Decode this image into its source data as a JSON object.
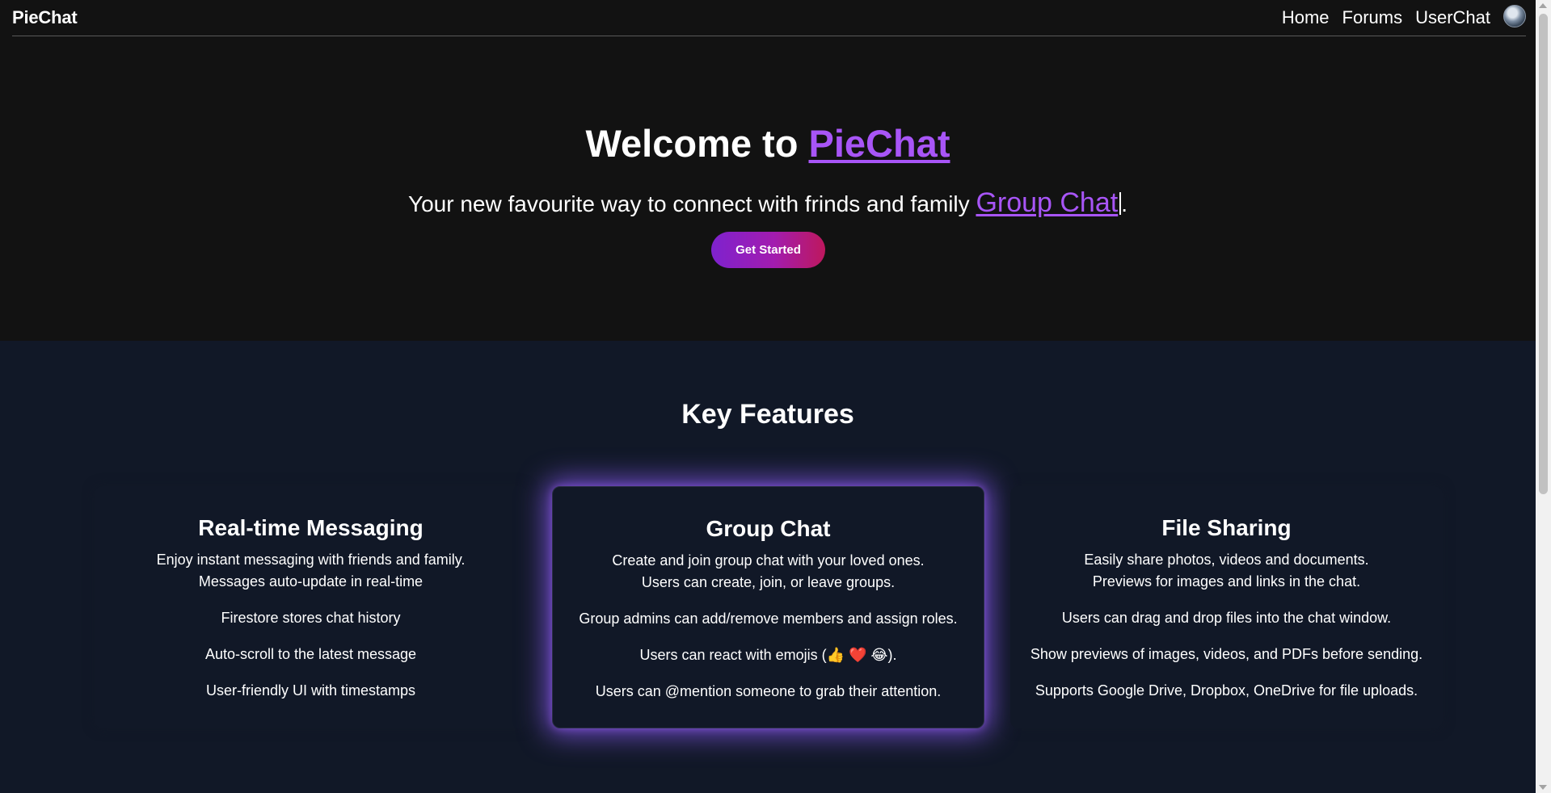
{
  "header": {
    "brand": "PieChat",
    "nav": [
      "Home",
      "Forums",
      "UserChat"
    ],
    "avatar_icon": "user-avatar-icon"
  },
  "hero": {
    "title_prefix": "Welcome to ",
    "title_link": "PieChat",
    "subtitle": "Your new favourite way to connect with frinds and family ",
    "typed_word": "Group Chat",
    "subtitle_end": ".",
    "cta_label": "Get Started"
  },
  "features": {
    "heading": "Key Features",
    "cards": [
      {
        "title": "Real-time Messaging",
        "desc": [
          "Enjoy instant messaging with friends and family.",
          "Messages auto-update in real-time"
        ],
        "items": [
          "Firestore stores chat history",
          "Auto-scroll to the latest message",
          "User-friendly UI with timestamps"
        ]
      },
      {
        "title": "Group Chat",
        "desc": [
          "Create and join group chat with your loved ones.",
          "Users can create, join, or leave groups."
        ],
        "items": [
          "Group admins can add/remove members and assign roles.",
          "Users can react with emojis (👍 ❤️ 😂).",
          "Users can @mention someone to grab their attention."
        ]
      },
      {
        "title": "File Sharing",
        "desc": [
          "Easily share photos, videos and documents.",
          "Previews for images and links in the chat."
        ],
        "items": [
          "Users can drag and drop files into the chat window.",
          "Show previews of images, videos, and PDFs before sending.",
          "Supports Google Drive, Dropbox, OneDrive for file uploads."
        ]
      }
    ]
  },
  "colors": {
    "accent": "#a855f7",
    "hero_bg": "#121212",
    "features_bg": "#111827",
    "cta_gradient": [
      "#7e22ce",
      "#be185d"
    ]
  }
}
